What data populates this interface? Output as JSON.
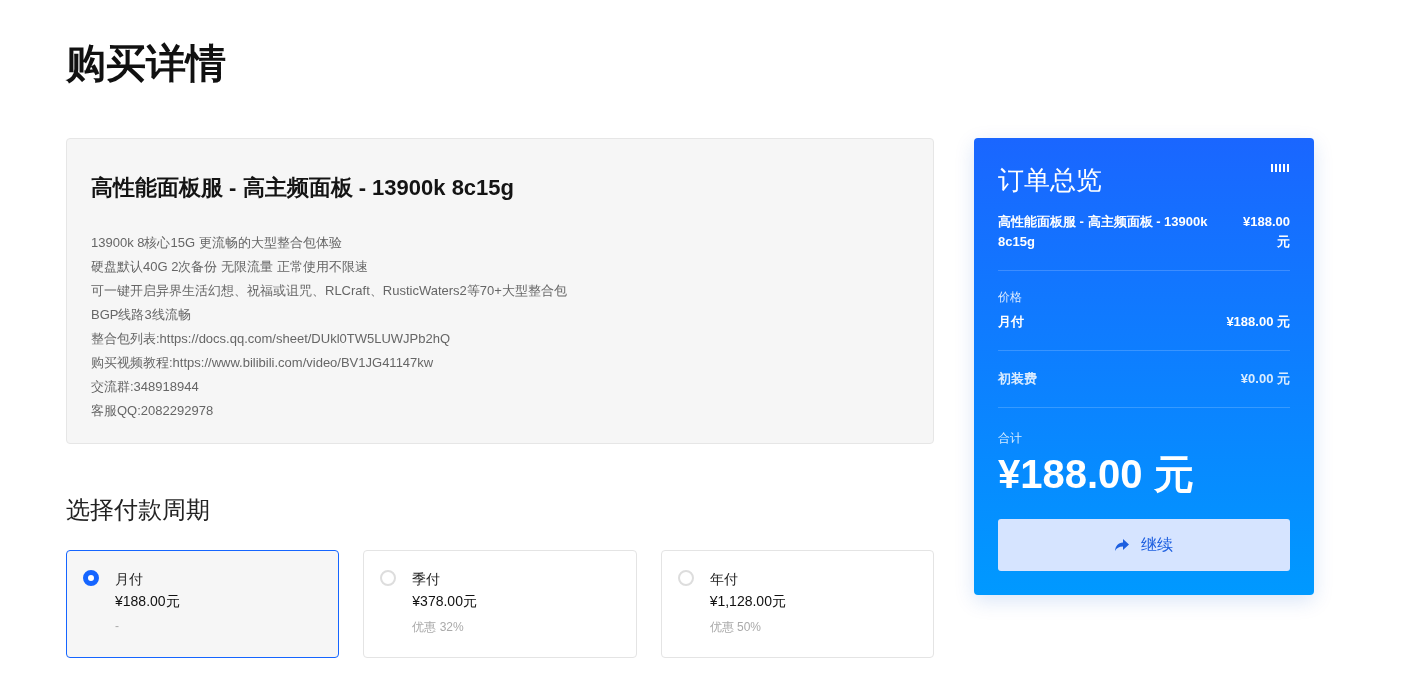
{
  "page_title": "购买详情",
  "product": {
    "title": "高性能面板服 - 高主频面板 - 13900k 8c15g",
    "description": [
      "13900k 8核心15G 更流畅的大型整合包体验",
      "硬盘默认40G 2次备份 无限流量 正常使用不限速",
      "可一键开启异界生活幻想、祝福或诅咒、RLCraft、RusticWaters2等70+大型整合包",
      "BGP线路3线流畅",
      "整合包列表:https://docs.qq.com/sheet/DUkl0TW5LUWJPb2hQ",
      "购买视频教程:https://www.bilibili.com/video/BV1JG41147kw",
      "交流群:348918944",
      "客服QQ:2082292978"
    ]
  },
  "billing": {
    "heading": "选择付款周期",
    "options": [
      {
        "label": "月付",
        "price": "¥188.00元",
        "note": "-",
        "selected": true
      },
      {
        "label": "季付",
        "price": "¥378.00元",
        "note": "优惠 32%",
        "selected": false
      },
      {
        "label": "年付",
        "price": "¥1,128.00元",
        "note": "优惠 50%",
        "selected": false
      }
    ]
  },
  "summary": {
    "title": "订单总览",
    "item_name": "高性能面板服 - 高主频面板 - 13900k 8c15g",
    "item_price": "¥188.00 元",
    "price_label": "价格",
    "cycle": "月付",
    "cycle_price": "¥188.00 元",
    "setup_label": "初装费",
    "setup_price": "¥0.00 元",
    "total_label": "合计",
    "total": "¥188.00 元",
    "button": "继续"
  }
}
